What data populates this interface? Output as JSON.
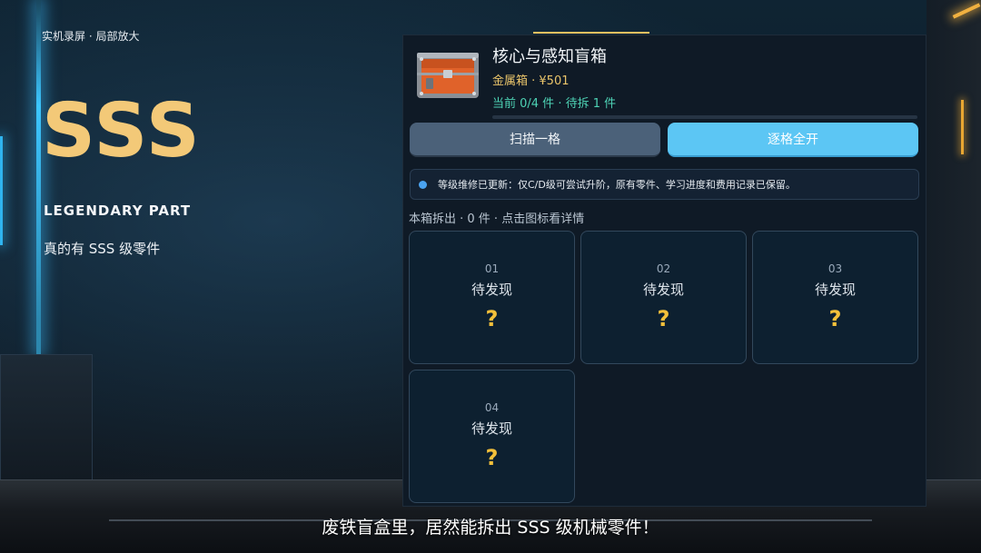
{
  "overlay": {
    "recording_label": "实机录屏 · 局部放大",
    "rank": "SSS",
    "rank_color": "#f3c978",
    "legend_label": "LEGENDARY PART",
    "claim": "真的有 SSS 级零件"
  },
  "box": {
    "title": "核心与感知盲箱",
    "meta": "金属箱 · ¥501",
    "progress_text": "当前 0/4 件 · 待拆 1 件",
    "progress_fraction": 0
  },
  "actions": {
    "scan_label": "扫描一格",
    "open_all_label": "逐格全开"
  },
  "notice": {
    "text": "等级维修已更新：仅C/D级可尝试升阶，原有零件、学习进度和费用记录已保留。"
  },
  "section": {
    "label": "本箱拆出 · 0 件 · 点击图标看详情"
  },
  "slots": [
    {
      "num": "01",
      "status": "待发现",
      "mark": "?"
    },
    {
      "num": "02",
      "status": "待发现",
      "mark": "?"
    },
    {
      "num": "03",
      "status": "待发现",
      "mark": "?"
    },
    {
      "num": "04",
      "status": "待发现",
      "mark": "?"
    }
  ],
  "subtitle": "废铁盲盒里，居然能拆出 SSS 级机械零件！",
  "colors": {
    "accent_gold": "#f3c978",
    "progress_teal": "#4ed3b5",
    "primary_button": "#5cc6f4",
    "secondary_button": "#4b6179"
  }
}
